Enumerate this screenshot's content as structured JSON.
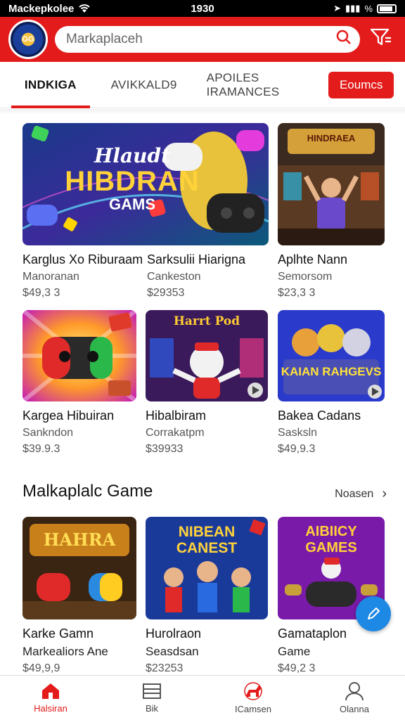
{
  "status_bar": {
    "carrier": "Mackepkolee",
    "time": "1930",
    "battery": "%"
  },
  "header": {
    "logo_text": "GG",
    "search_placeholder": "Markaplaceh"
  },
  "tabs": [
    {
      "label": "INDKIGA"
    },
    {
      "label": "AVIKKALD9"
    },
    {
      "label": "APOILES IRAMANCES"
    }
  ],
  "tab_button": "Eoumcs",
  "grid": [
    {
      "title": "Karglus Xo Riburaam",
      "subtitle": "Manoranan",
      "price": "$49,3 3",
      "image_text": "Hlaudt HIBDRAN GAMS"
    },
    {
      "title": "Sarksulii Hiarigna",
      "subtitle": "Cankeston",
      "price": "$29353",
      "image_text": "HINDRAEA"
    },
    {
      "title": "Aplhte Nann",
      "subtitle": "Semorsom",
      "price": "$23,3 3",
      "image_text": ""
    },
    {
      "title": "Kargea Hibuiran",
      "subtitle": "Sankndon",
      "price": "$39.9.3",
      "image_text": ""
    },
    {
      "title": "Hibalbiram",
      "subtitle": "Corrakatpm",
      "price": "$39933",
      "image_text": "Harrt Pod"
    },
    {
      "title": "Bakea Cadans",
      "subtitle": "Sasksln",
      "price": "$49,9.3",
      "image_text": "KAIAN RAHGEVS"
    }
  ],
  "section": {
    "title": "Malkaplalc Game",
    "see_all": "Noasen"
  },
  "row": [
    {
      "title": "Karke Gamn",
      "subtitle": "Markealiors Ane",
      "price": "$49,9,9",
      "image_text": "HAHRA"
    },
    {
      "title": "Hurolraon",
      "subtitle": "Seasdsan",
      "price": "$23253",
      "image_text": "NIBEAN CANEST"
    },
    {
      "title": "Gamataplon",
      "subtitle": "Game",
      "price": "$49,2 3",
      "image_text": "AIBIICY GAMES"
    }
  ],
  "bottom_nav": [
    {
      "label": "Halsiran",
      "icon": "home-icon"
    },
    {
      "label": "Bik",
      "icon": "list-icon"
    },
    {
      "label": "ICamsen",
      "icon": "dog-icon"
    },
    {
      "label": "Olanna",
      "icon": "person-icon"
    }
  ],
  "colors": {
    "accent": "#e31b1b",
    "fab": "#1e88e5"
  }
}
